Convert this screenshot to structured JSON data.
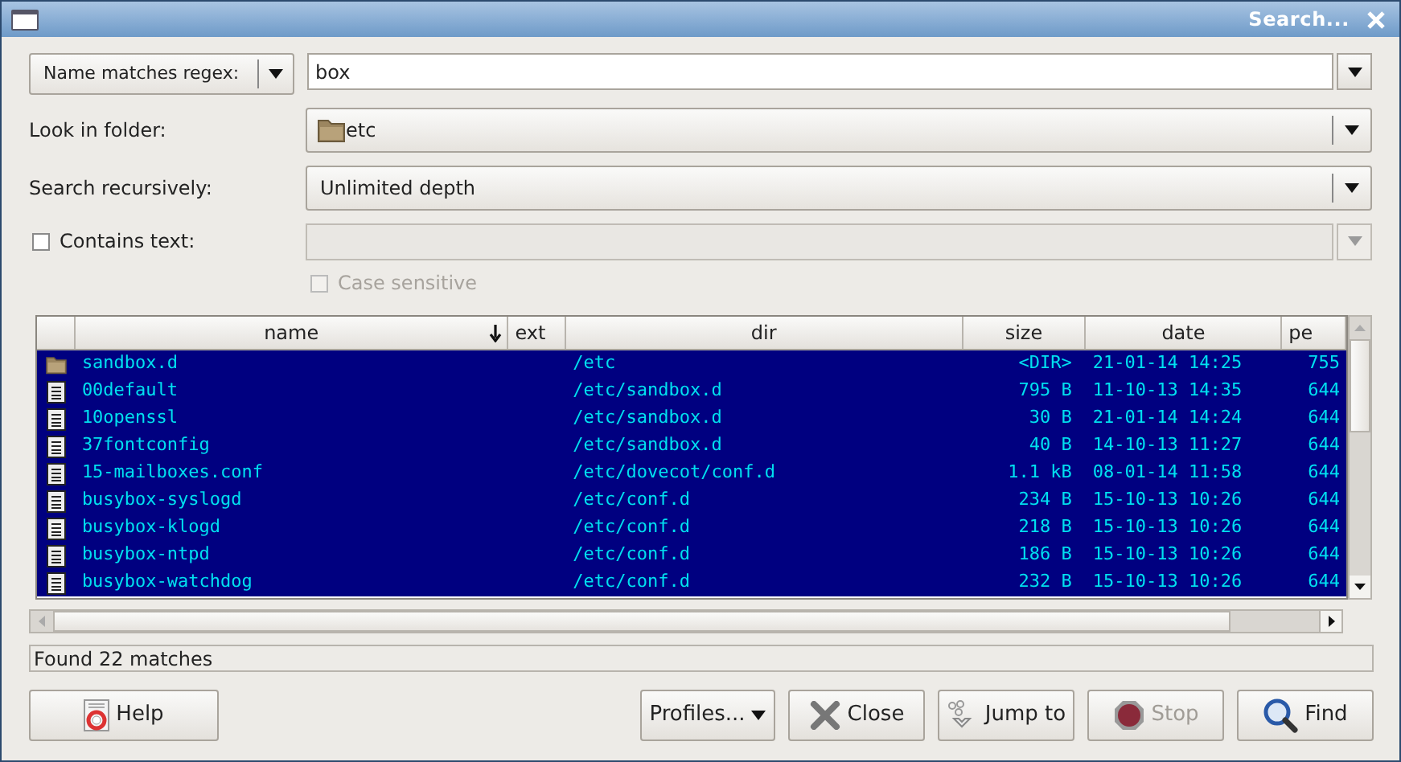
{
  "window": {
    "title": "Search..."
  },
  "criteria": {
    "mode": "Name matches regex:",
    "pattern": "box"
  },
  "look_in": {
    "label": "Look in folder:",
    "value": "etc"
  },
  "recursive": {
    "label": "Search recursively:",
    "value": "Unlimited depth"
  },
  "contains_text": {
    "label": "Contains text:",
    "checked": false
  },
  "case_sensitive": {
    "label": "Case sensitive",
    "checked": false,
    "disabled": true
  },
  "table": {
    "columns": [
      {
        "label": "name",
        "sorted": true
      },
      {
        "label": "ext",
        "sorted": false
      },
      {
        "label": "dir",
        "sorted": false
      },
      {
        "label": "size",
        "sorted": false
      },
      {
        "label": "date",
        "sorted": false
      },
      {
        "label": "pe",
        "sorted": false
      }
    ],
    "rows": [
      {
        "kind": "folder",
        "name": "sandbox.d",
        "dir": "/etc",
        "size": "<DIR>",
        "date": "21-01-14 14:25",
        "perm": "755",
        "selected": true
      },
      {
        "kind": "file",
        "name": "00default",
        "dir": "/etc/sandbox.d",
        "size": "795 B",
        "date": "11-10-13 14:35",
        "perm": "644",
        "selected": true
      },
      {
        "kind": "file",
        "name": "10openssl",
        "dir": "/etc/sandbox.d",
        "size": "30 B",
        "date": "21-01-14 14:24",
        "perm": "644",
        "selected": true
      },
      {
        "kind": "file",
        "name": "37fontconfig",
        "dir": "/etc/sandbox.d",
        "size": "40 B",
        "date": "14-10-13 11:27",
        "perm": "644",
        "selected": true
      },
      {
        "kind": "file",
        "name": "15-mailboxes.conf",
        "dir": "/etc/dovecot/conf.d",
        "size": "1.1 kB",
        "date": "08-01-14 11:58",
        "perm": "644",
        "selected": true
      },
      {
        "kind": "file",
        "name": "busybox-syslogd",
        "dir": "/etc/conf.d",
        "size": "234 B",
        "date": "15-10-13 10:26",
        "perm": "644",
        "selected": true
      },
      {
        "kind": "file",
        "name": "busybox-klogd",
        "dir": "/etc/conf.d",
        "size": "218 B",
        "date": "15-10-13 10:26",
        "perm": "644",
        "selected": true
      },
      {
        "kind": "file",
        "name": "busybox-ntpd",
        "dir": "/etc/conf.d",
        "size": "186 B",
        "date": "15-10-13 10:26",
        "perm": "644",
        "selected": true
      },
      {
        "kind": "file",
        "name": "busybox-watchdog",
        "dir": "/etc/conf.d",
        "size": "232 B",
        "date": "15-10-13 10:26",
        "perm": "644",
        "selected": true
      }
    ]
  },
  "status_bar": "Found 22 matches",
  "buttons": [
    {
      "kind": "help",
      "label": "Help",
      "disabled": false
    },
    {
      "kind": "profiles",
      "label": "Profiles...",
      "disabled": false
    },
    {
      "kind": "close",
      "label": "Close",
      "disabled": false
    },
    {
      "kind": "jump",
      "label": "Jump to",
      "disabled": false
    },
    {
      "kind": "stop",
      "label": "Stop",
      "disabled": true
    },
    {
      "kind": "find",
      "label": "Find",
      "disabled": false
    }
  ]
}
